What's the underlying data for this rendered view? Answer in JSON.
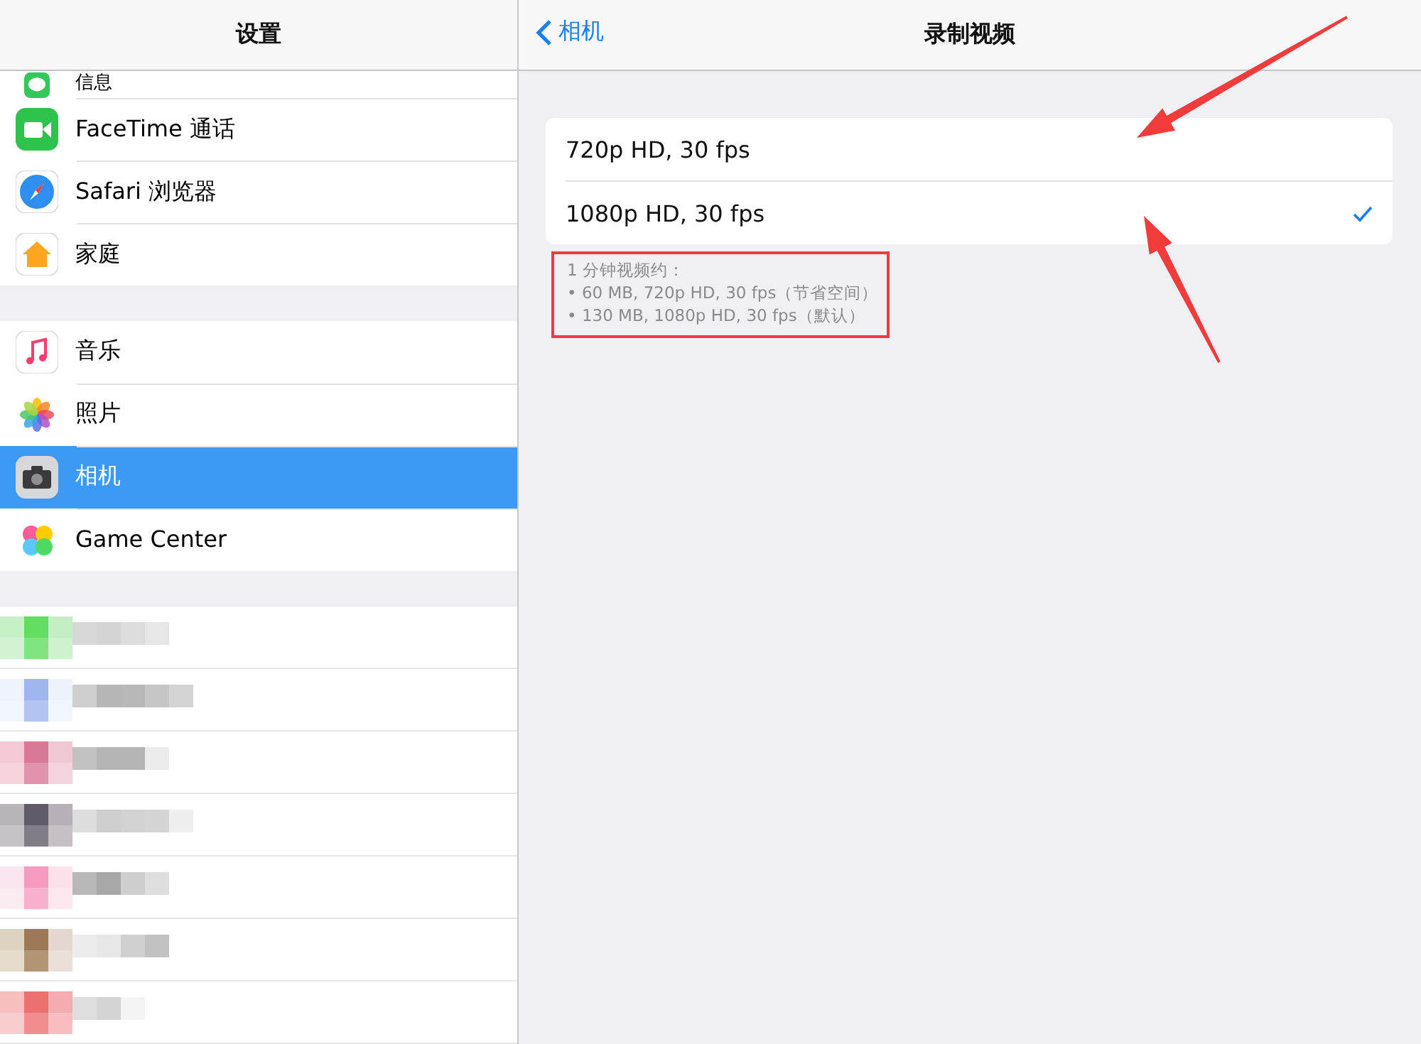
{
  "sidebar": {
    "title": "设置",
    "groups": [
      [
        {
          "kind": "messages",
          "label": "信息",
          "selected": false
        },
        {
          "kind": "facetime",
          "label": "FaceTime 通话",
          "selected": false
        },
        {
          "kind": "safari",
          "label": "Safari 浏览器",
          "selected": false
        },
        {
          "kind": "home",
          "label": "家庭",
          "selected": false
        }
      ],
      [
        {
          "kind": "music",
          "label": "音乐",
          "selected": false
        },
        {
          "kind": "photos",
          "label": "照片",
          "selected": false
        },
        {
          "kind": "camera",
          "label": "相机",
          "selected": true
        },
        {
          "kind": "gamecenter",
          "label": "Game Center",
          "selected": false
        }
      ]
    ]
  },
  "detail": {
    "back": "相机",
    "title": "录制视频",
    "options": [
      {
        "label": "720p HD, 30 fps",
        "checked": false
      },
      {
        "label": "1080p HD, 30 fps",
        "checked": true
      }
    ],
    "footer": [
      "1 分钟视频约：",
      "• 60 MB, 720p HD, 30 fps（节省空间）",
      "• 130 MB, 1080p HD, 30 fps（默认）"
    ]
  },
  "annotations": [
    {
      "kind": "arrow"
    },
    {
      "kind": "arrow"
    },
    {
      "kind": "box"
    }
  ]
}
